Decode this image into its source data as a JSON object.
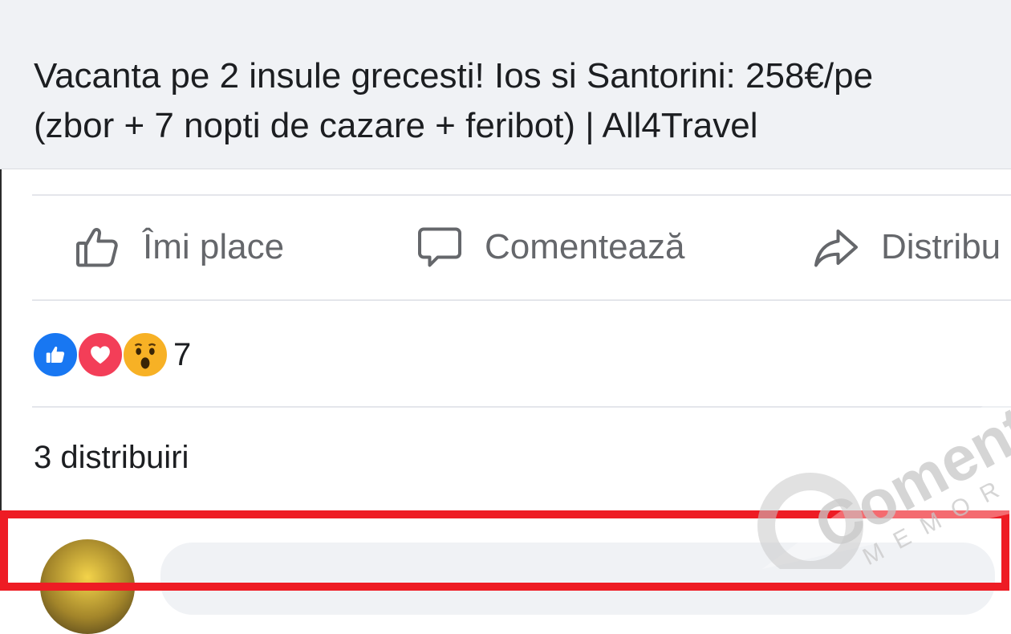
{
  "post": {
    "link_title_line1": "Vacanta pe 2 insule grecesti! Ios si Santorini: 258€/pe",
    "link_title_line2": "(zbor + 7 nopti de cazare + feribot) | All4Travel"
  },
  "actions": {
    "like_label": "Îmi place",
    "comment_label": "Comentează",
    "share_label": "Distribu"
  },
  "reactions": {
    "icons": [
      "like-reaction-icon",
      "love-reaction-icon",
      "wow-reaction-icon"
    ],
    "count": "7"
  },
  "shares": {
    "label": "3 distribuiri"
  },
  "colors": {
    "like_blue": "#1877f2",
    "love_red": "#f33e58",
    "wow_yellow": "#f7b125",
    "highlight_red": "#ee1c24",
    "action_gray": "#65676b"
  },
  "watermark": {
    "text": "Comenta",
    "subtext": "MEMORA"
  }
}
